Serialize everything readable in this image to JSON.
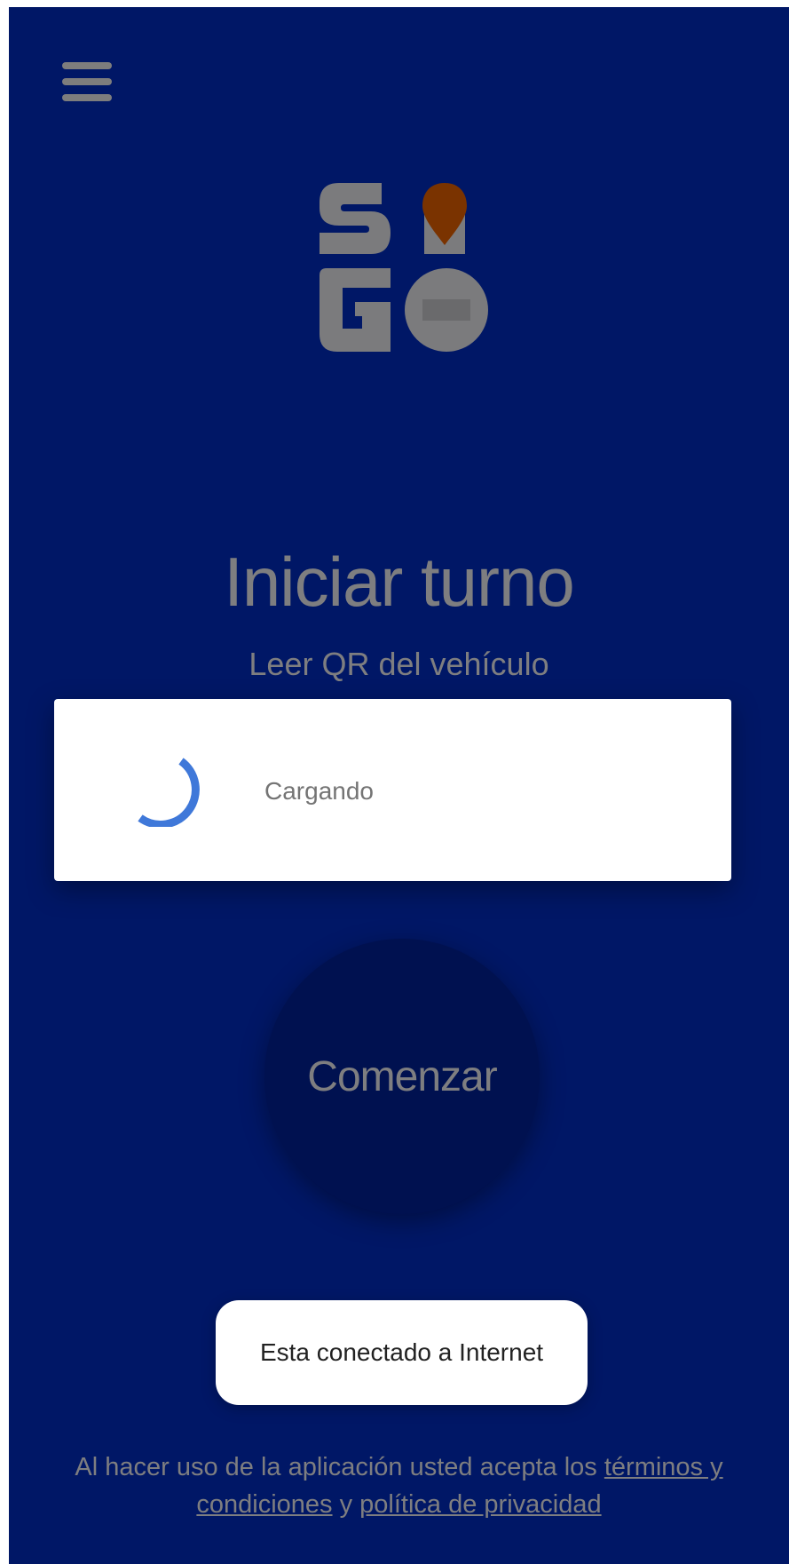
{
  "header": {
    "menu_icon": "hamburger-menu-icon"
  },
  "logo": {
    "text": "SIGO",
    "pin_color": "#7a3300"
  },
  "main": {
    "title": "Iniciar turno",
    "subtitle": "Leer QR del vehículo",
    "start_label": "Comenzar"
  },
  "loading_dialog": {
    "text": "Cargando",
    "spinner_color": "#3f78d9"
  },
  "toast": {
    "text": "Esta conectado a Internet"
  },
  "legal": {
    "prefix": "Al hacer uso de la aplicación usted acepta los ",
    "terms_link": "términos y condiciones",
    "connector": " y ",
    "privacy_link": "política de privacidad"
  },
  "colors": {
    "background": "#001766",
    "button": "#001150",
    "text_muted": "#7e7e80"
  }
}
